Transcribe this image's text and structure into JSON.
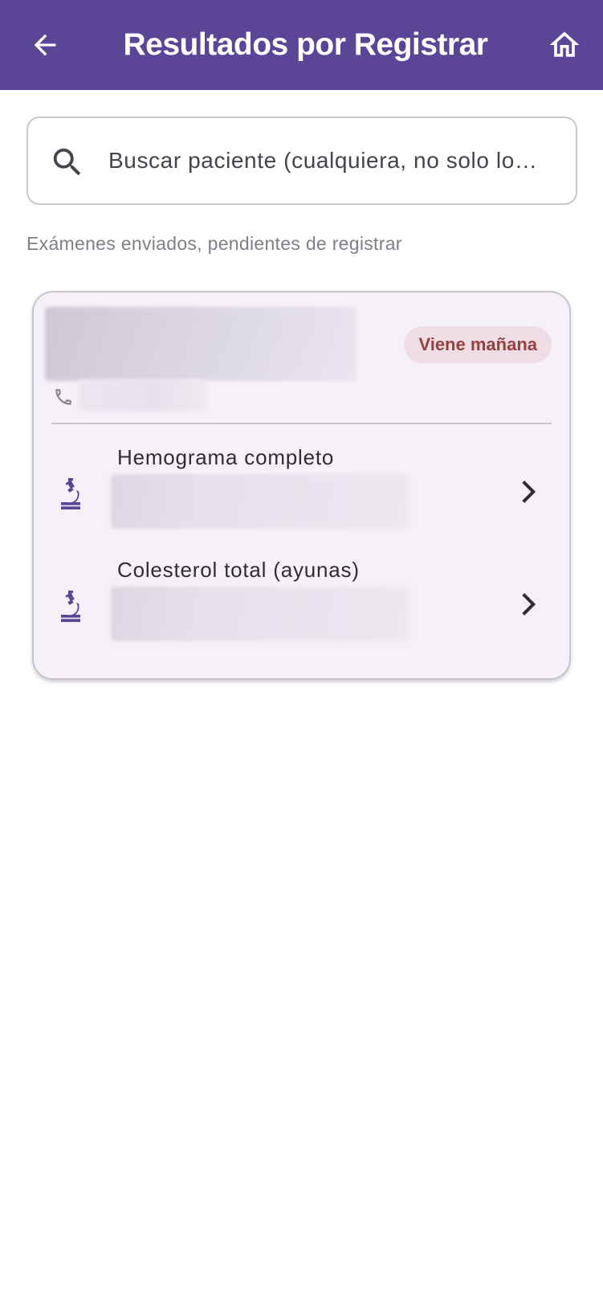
{
  "app_bar": {
    "title": "Resultados por Registrar",
    "background": "#5b4597",
    "back_icon": "arrow-left-icon",
    "home_icon": "home-icon"
  },
  "search": {
    "placeholder": "Buscar paciente (cualquiera, no solo lo…",
    "icon": "search-icon"
  },
  "section_caption": "Exámenes enviados, pendientes de registrar",
  "patient_card": {
    "status_chip": "Viene mañana",
    "status_colors": {
      "background": "#eedde4",
      "text": "#95423f"
    },
    "phone_icon": "phone-icon",
    "exams": [
      {
        "name": "Hemograma completo",
        "icon": "microscope-icon"
      },
      {
        "name": "Colesterol total (ayunas)",
        "icon": "microscope-icon"
      }
    ]
  },
  "colors": {
    "accent": "#5b4597",
    "card_background": "#f6f1f8"
  }
}
